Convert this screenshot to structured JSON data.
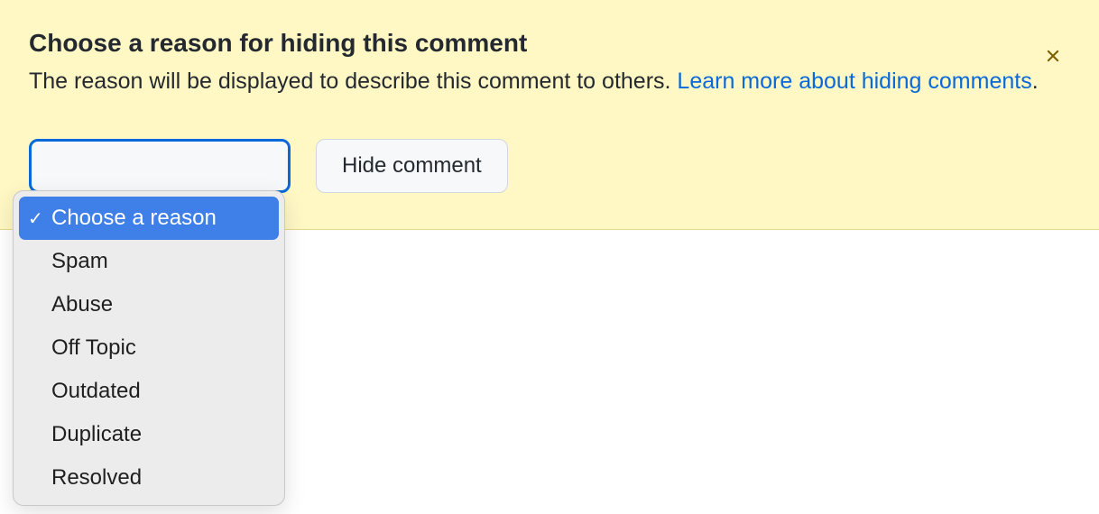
{
  "banner": {
    "title": "Choose a reason for hiding this comment",
    "subtitle_prefix": "The reason will be displayed to describe this comment to others. ",
    "link_text": "Learn more about hiding comments",
    "subtitle_suffix": "."
  },
  "controls": {
    "hide_button_label": "Hide comment"
  },
  "dropdown": {
    "options": [
      {
        "label": "Choose a reason",
        "selected": true
      },
      {
        "label": "Spam",
        "selected": false
      },
      {
        "label": "Abuse",
        "selected": false
      },
      {
        "label": "Off Topic",
        "selected": false
      },
      {
        "label": "Outdated",
        "selected": false
      },
      {
        "label": "Duplicate",
        "selected": false
      },
      {
        "label": "Resolved",
        "selected": false
      }
    ]
  }
}
